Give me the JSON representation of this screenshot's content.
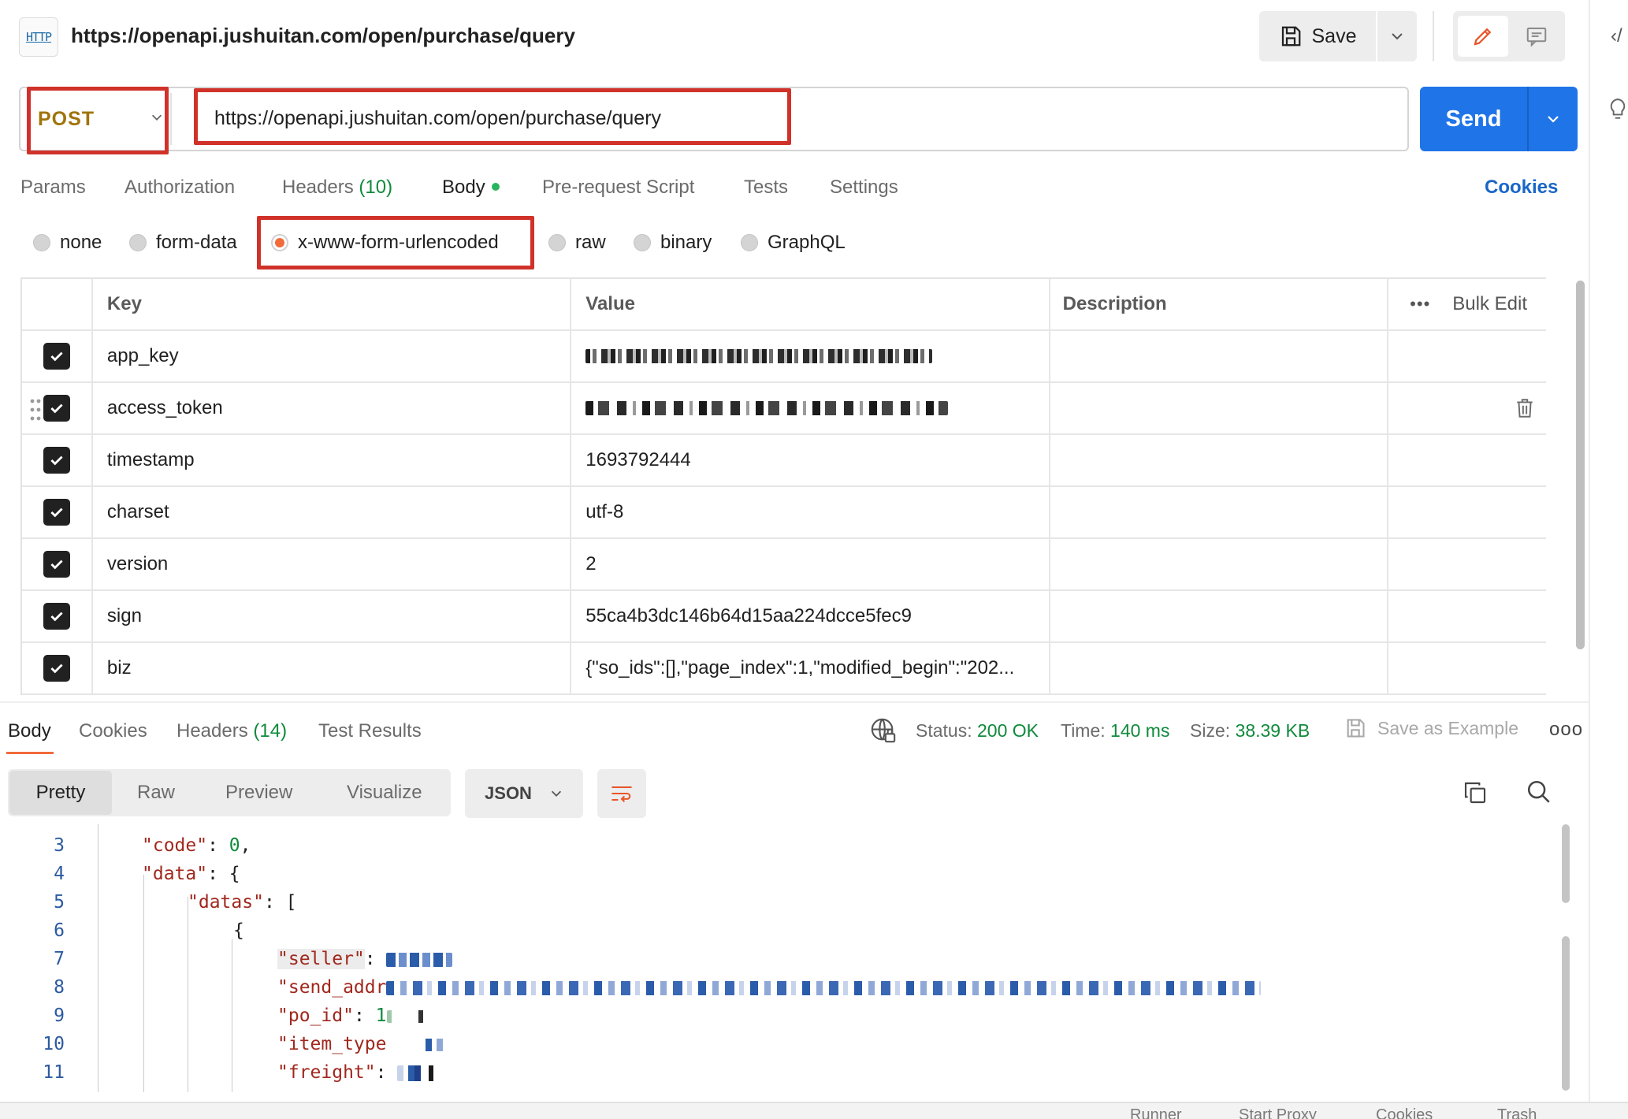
{
  "header": {
    "http_badge": "HTTP",
    "title": "https://openapi.jushuitan.com/open/purchase/query",
    "save_label": "Save"
  },
  "request": {
    "method": "POST",
    "url": "https://openapi.jushuitan.com/open/purchase/query",
    "send_label": "Send"
  },
  "tabs": {
    "params": "Params",
    "authorization": "Authorization",
    "headers": "Headers",
    "headers_count": "(10)",
    "body": "Body",
    "pre_request": "Pre-request Script",
    "tests": "Tests",
    "settings": "Settings",
    "cookies": "Cookies"
  },
  "body_types": {
    "none": "none",
    "form_data": "form-data",
    "urlencoded": "x-www-form-urlencoded",
    "raw": "raw",
    "binary": "binary",
    "graphql": "GraphQL"
  },
  "table": {
    "headers": {
      "key": "Key",
      "value": "Value",
      "description": "Description",
      "bulk_edit": "Bulk Edit"
    },
    "rows": [
      {
        "key": "app_key",
        "value": ""
      },
      {
        "key": "access_token",
        "value": ""
      },
      {
        "key": "timestamp",
        "value": "1693792444"
      },
      {
        "key": "charset",
        "value": "utf-8"
      },
      {
        "key": "version",
        "value": "2"
      },
      {
        "key": "sign",
        "value": "55ca4b3dc146b64d15aa224dcce5fec9"
      },
      {
        "key": "biz",
        "value": "{\"so_ids\":[],\"page_index\":1,\"modified_begin\":\"202..."
      }
    ]
  },
  "response": {
    "tabs": {
      "body": "Body",
      "cookies": "Cookies",
      "headers": "Headers",
      "headers_count": "(14)",
      "test_results": "Test Results"
    },
    "status_label": "Status:",
    "status_value": "200 OK",
    "time_label": "Time:",
    "time_value": "140 ms",
    "size_label": "Size:",
    "size_value": "38.39 KB",
    "save_example": "Save as Example",
    "views": {
      "pretty": "Pretty",
      "raw": "Raw",
      "preview": "Preview",
      "visualize": "Visualize"
    },
    "format": "JSON",
    "code": {
      "lines": [
        "3",
        "4",
        "5",
        "6",
        "7",
        "8",
        "9",
        "10",
        "11"
      ],
      "l3_key": "\"code\"",
      "l3_val": "0",
      "l4_key": "\"data\"",
      "l5_key": "\"datas\"",
      "l7_key": "\"seller\"",
      "l8_key": "\"send_addr",
      "l9_key": "\"po_id\"",
      "l9_val": "1",
      "l10_key": "\"item_type",
      "l11_key": "\"freight\""
    }
  },
  "footer": {
    "runner": "Runner",
    "start_proxy": "Start Proxy",
    "cookies": "Cookies",
    "trash": "Trash"
  },
  "colors": {
    "send_blue": "#1f74e8",
    "method_gold": "#a0740a",
    "highlight_red": "#d0322a",
    "status_green": "#0f8a3c",
    "radio_orange": "#f26b3a"
  }
}
